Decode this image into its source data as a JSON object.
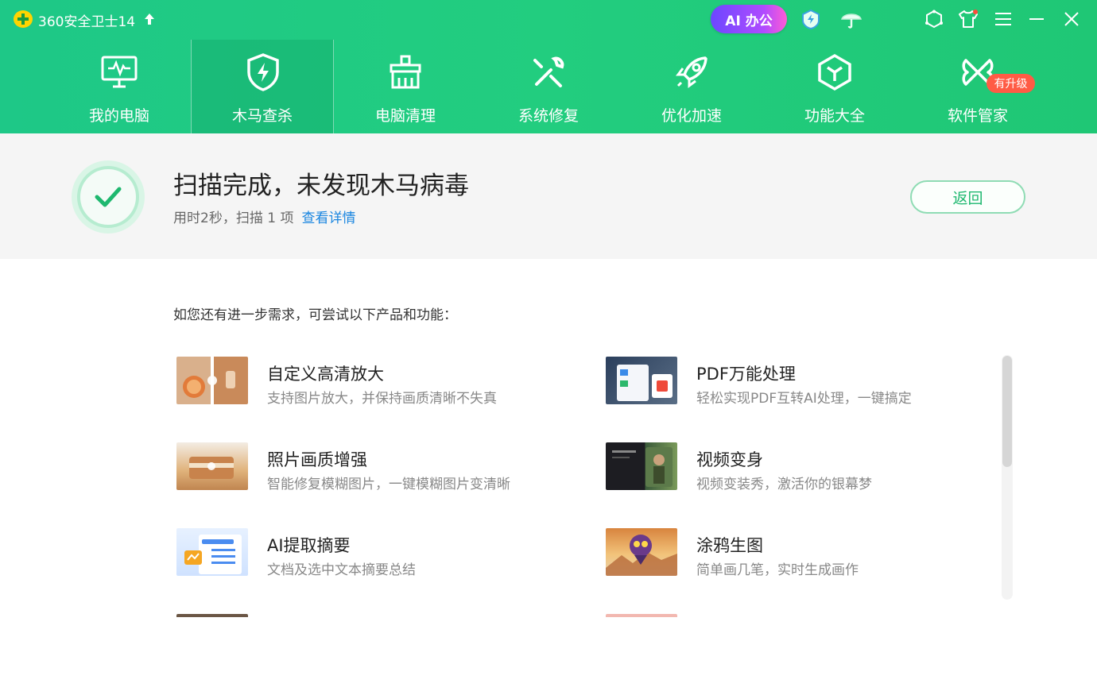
{
  "window": {
    "title": "360安全卫士14",
    "ai_button": "AI 办公",
    "colors": {
      "header": "#22cd7f",
      "accent_green": "#1eb86f",
      "link": "#1a86e0",
      "badge": "#ff5b45"
    }
  },
  "nav": {
    "items": [
      {
        "label": "我的电脑",
        "icon": "monitor-icon"
      },
      {
        "label": "木马查杀",
        "icon": "shield-bolt-icon",
        "active": true
      },
      {
        "label": "电脑清理",
        "icon": "broom-icon"
      },
      {
        "label": "系统修复",
        "icon": "wrench-icon"
      },
      {
        "label": "优化加速",
        "icon": "rocket-icon"
      },
      {
        "label": "功能大全",
        "icon": "cube-icon"
      },
      {
        "label": "软件管家",
        "icon": "apps-icon"
      }
    ],
    "upgrade_badge": "有升级"
  },
  "result": {
    "title": "扫描完成，未发现木马病毒",
    "subtitle": "用时2秒，扫描 1 项",
    "detail_link": "查看详情",
    "back_button": "返回"
  },
  "suggestions": {
    "hint": "如您还有进一步需求，可尝试以下产品和功能：",
    "items": [
      {
        "title": "自定义高清放大",
        "desc": "支持图片放大，并保持画质清晰不失真"
      },
      {
        "title": "PDF万能处理",
        "desc": "轻松实现PDF互转AI处理，一键搞定"
      },
      {
        "title": "照片画质增强",
        "desc": "智能修复模糊图片，一键模糊图片变清晰"
      },
      {
        "title": "视频变身",
        "desc": "视频变装秀，激活你的银幕梦"
      },
      {
        "title": "AI提取摘要",
        "desc": "文档及选中文本摘要总结"
      },
      {
        "title": "涂鸦生图",
        "desc": "简单画几笔，实时生成画作"
      }
    ]
  }
}
